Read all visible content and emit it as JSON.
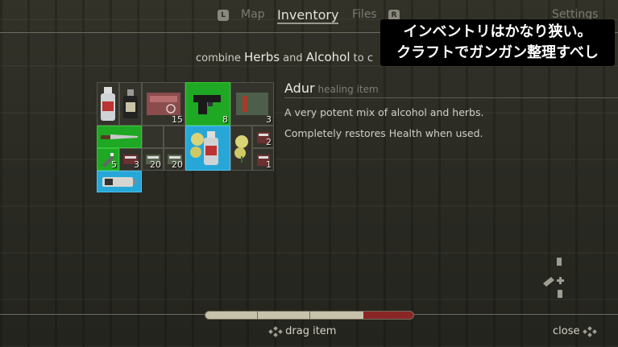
{
  "nav": {
    "left_key": "L",
    "right_key": "R",
    "tabs": [
      {
        "label": "Map",
        "active": false
      },
      {
        "label": "Inventory",
        "active": true
      },
      {
        "label": "Files",
        "active": false
      }
    ],
    "settings_label": "Settings"
  },
  "caption": {
    "line1": "インベントリはかなり狭い。",
    "line2": "クラフトでガンガン整理すべし"
  },
  "hint": {
    "prefix": "combine",
    "herbs": "Herbs",
    "and": "and",
    "alcohol": "Alcohol",
    "suffix": "to c"
  },
  "inventory": {
    "slots": [
      {
        "item": "alcohol-bottle",
        "count": "",
        "highlight": "none"
      },
      {
        "item": "ink-bottle",
        "count": "",
        "highlight": "none"
      },
      {
        "item": "shotgun-shells-box",
        "count": "15",
        "highlight": "none"
      },
      {
        "item": "pistol",
        "count": "8",
        "highlight": "green"
      },
      {
        "item": "shell-box",
        "count": "3",
        "highlight": "none"
      },
      {
        "item": "knife",
        "count": "",
        "highlight": "green"
      },
      {
        "item": "empty",
        "count": "",
        "highlight": "none"
      },
      {
        "item": "adur-herb-bottle",
        "count": "",
        "highlight": "blue"
      },
      {
        "item": "herb-bundle",
        "count": "",
        "highlight": "none"
      },
      {
        "item": "ammo-pack",
        "count": "2",
        "highlight": "none"
      },
      {
        "item": "syringe-green",
        "count": "5",
        "highlight": "green"
      },
      {
        "item": "ammo-box",
        "count": "3",
        "highlight": "none"
      },
      {
        "item": "ammo-box",
        "count": "20",
        "highlight": "none"
      },
      {
        "item": "ammo-box",
        "count": "20",
        "highlight": "none"
      },
      {
        "item": "herb-bundle",
        "count": "",
        "highlight": "none"
      },
      {
        "item": "ammo-pack",
        "count": "1",
        "highlight": "none"
      },
      {
        "item": "battery",
        "count": "",
        "highlight": "blue"
      }
    ]
  },
  "detail": {
    "name": "Adur",
    "type": "healing item",
    "description": "A very potent mix of alcohol and herbs.",
    "effect": "Completely restores Health when used."
  },
  "health_bar": {
    "value": 0.76,
    "colors": {
      "filled": "#c7c2aa",
      "danger": "#8a2626"
    }
  },
  "footer": {
    "drag_label": "drag item",
    "close_label": "close"
  },
  "colors": {
    "slot_green": "#1fa823",
    "slot_blue": "#27a7d8",
    "caption_bg": "#000000"
  }
}
